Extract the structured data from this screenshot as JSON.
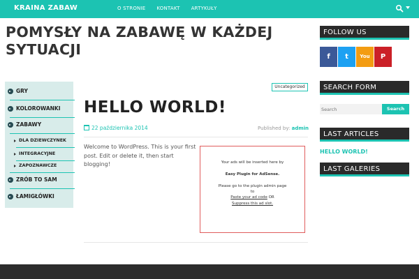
{
  "header": {
    "brand": "KRAINA ZABAW",
    "nav": [
      "O STRONIE",
      "KONTAKT",
      "ARTYKUŁY"
    ],
    "accent": "#1cc3b2"
  },
  "page": {
    "heading": "POMYSŁY NA ZABAWĘ W KAŻDEJ SYTUACJI"
  },
  "menu": {
    "items": [
      "GRY",
      "KOLOROWANKI",
      "ZABAWY",
      "ZRÓB TO SAM",
      "ŁAMIGŁÓWKI"
    ],
    "subitems": [
      "DLA DZIEWCZYNEK",
      "INTEGRACYJNE",
      "ZAPOZNAWCZE"
    ]
  },
  "post": {
    "category": "Uncategorized",
    "title": "HELLO WORLD!",
    "date": "22 października 2014",
    "published_label": "Published by:",
    "author": "admin",
    "body": "Welcome to WordPress. This is your first post. Edit or delete it, then start blogging!"
  },
  "ad": {
    "line1": "Your ads will be inserted here by",
    "line2": "Easy Plugin for AdSense.",
    "line3": "Please go to the plugin admin page",
    "line4": "to",
    "link1": "Paste your ad code",
    "or": "OR",
    "link2": "Suppress this ad slot."
  },
  "sidebar": {
    "follow_title": "FOLLOW US",
    "social": [
      {
        "name": "facebook",
        "glyph": "f",
        "color": "#3b5998"
      },
      {
        "name": "twitter",
        "glyph": "t",
        "color": "#1da1f2"
      },
      {
        "name": "youtube",
        "glyph": "You",
        "color": "#f39c12"
      },
      {
        "name": "pinterest",
        "glyph": "P",
        "color": "#cb2027"
      }
    ],
    "search_title": "SEARCH FORM",
    "search_placeholder": "Search",
    "search_button": "Search",
    "articles_title": "LAST ARTICLES",
    "articles": [
      "HELLO WORLD!"
    ],
    "galleries_title": "LAST GALERIES"
  }
}
